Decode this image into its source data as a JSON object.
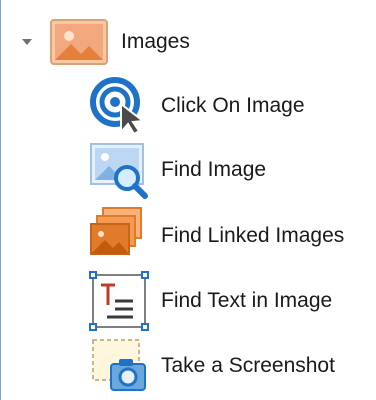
{
  "tree": {
    "group": {
      "label": "Images",
      "expanded": true,
      "icon": "image-folder-icon"
    },
    "items": [
      {
        "label": "Click On Image",
        "icon": "target-cursor-icon"
      },
      {
        "label": "Find Image",
        "icon": "image-search-icon"
      },
      {
        "label": "Find Linked Images",
        "icon": "stacked-images-icon"
      },
      {
        "label": "Find Text in Image",
        "icon": "text-frame-icon"
      },
      {
        "label": "Take a Screenshot",
        "icon": "camera-screenshot-icon"
      }
    ]
  },
  "colors": {
    "accent": "#1e73c8",
    "orange": "#e07b2a",
    "border": "#7aa7d6"
  }
}
